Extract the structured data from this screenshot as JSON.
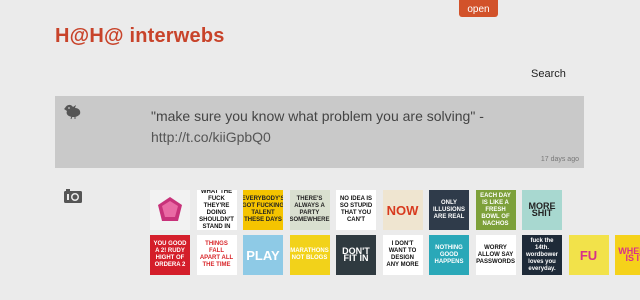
{
  "header": {
    "open_tab": "open",
    "site_title": "H@H@ interwebs",
    "search_label": "Search"
  },
  "tweet": {
    "text": "\"make sure you know what problem you are solving\" - ",
    "link": "http://t.co/kiiGpbQ0",
    "age": "17 days ago"
  },
  "icons": {
    "tweet": "bird-icon",
    "photos": "camera-icon"
  },
  "photos": [
    {
      "text": "",
      "bg": "#f2f2f2",
      "fg": "#c8327a"
    },
    {
      "text": "PEOPLE WHO DON'T KNOW WHAT THE FUCK THEY'RE DOING SHOULDN'T STAND IN THE WAY OF PEOPLE WHO DO",
      "bg": "#ffffff",
      "fg": "#111111"
    },
    {
      "text": "EVERYBODY'S GOT FUCKING TALENT THESE DAYS",
      "bg": "#f5c400",
      "fg": "#222222"
    },
    {
      "text": "THERE'S ALWAYS A PARTY SOMEWHERE",
      "bg": "#d9e0d0",
      "fg": "#222222"
    },
    {
      "text": "NO IDEA IS SO STUPID THAT YOU CAN'T",
      "bg": "#ffffff",
      "fg": "#111111"
    },
    {
      "text": "NOW",
      "bg": "#efe5d0",
      "fg": "#d83a1e"
    },
    {
      "text": "ONLY ILLUSIONS ARE REAL",
      "bg": "#2f3b4a",
      "fg": "#ffffff"
    },
    {
      "text": "EACH DAY IS LIKE A FRESH BOWL OF NACHOS",
      "bg": "#7da03a",
      "fg": "#ffffff"
    },
    {
      "text": "MORE SHIT",
      "bg": "#a8d8d0",
      "fg": "#222222"
    },
    {
      "text": "YOU GOOD A 2! RUDY HIGHT OF ORDERA 2",
      "bg": "#d41e2a",
      "fg": "#ffffff"
    },
    {
      "text": "THINGS FALL APART ALL THE TIME",
      "bg": "#ffffff",
      "fg": "#d8262a"
    },
    {
      "text": "PLAY",
      "bg": "#8ecae6",
      "fg": "#ffffff"
    },
    {
      "text": "MARATHONS NOT BLOGS",
      "bg": "#f2d21a",
      "fg": "#ffffff"
    },
    {
      "text": "DON'T FIT IN",
      "bg": "#2f3a40",
      "fg": "#ffffff"
    },
    {
      "text": "I DON'T WANT TO DESIGN ANY MORE",
      "bg": "#ffffff",
      "fg": "#111111"
    },
    {
      "text": "NOTHING GOOD HAPPENS",
      "bg": "#2aa8b8",
      "fg": "#ffffff"
    },
    {
      "text": "WORRY ALLOW SAY PASSWORDS",
      "bg": "#ffffff",
      "fg": "#111111"
    },
    {
      "text": "fuck the 14th. wordbower loves you everyday.",
      "bg": "#1e2a38",
      "fg": "#ffffff"
    },
    {
      "text": "FU",
      "bg": "#f2e24a",
      "fg": "#d8308a"
    },
    {
      "text": "WHERE IS IT",
      "bg": "#f5d21a",
      "fg": "#d8308a"
    }
  ]
}
